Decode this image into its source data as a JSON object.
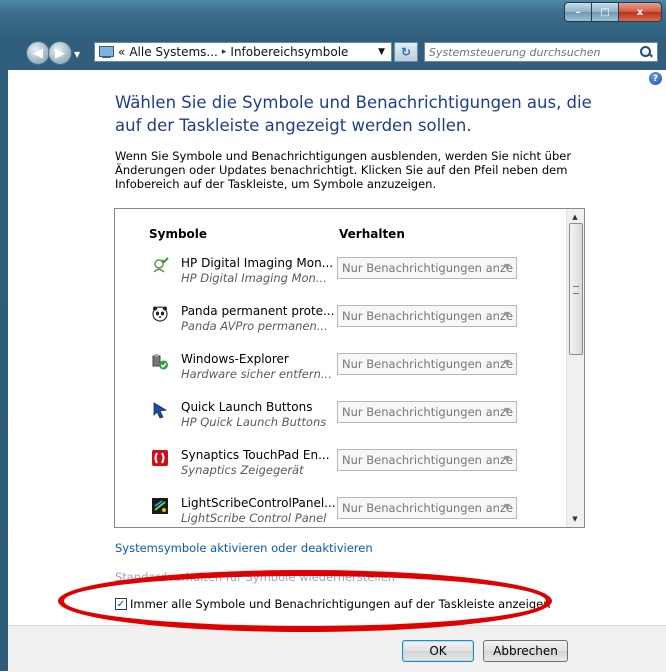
{
  "window": {
    "caption_buttons": {
      "minimize": "–",
      "maximize": "□",
      "close": "x"
    }
  },
  "nav": {
    "address": {
      "prefix": "«",
      "crumb1": "Alle Systems...",
      "separator": "▸",
      "crumb2": "Infobereichsymbole"
    },
    "search_placeholder": "Systemsteuerung durchsuchen"
  },
  "content": {
    "help": "?",
    "heading": "Wählen Sie die Symbole und Benachrichtigungen aus, die auf der Taskleiste angezeigt werden sollen.",
    "description": "Wenn Sie Symbole und Benachrichtigungen ausblenden, werden Sie nicht über Änderungen oder Updates benachrichtigt. Klicken Sie auf den Pfeil neben dem Infobereich auf der Taskleiste, um Symbole anzuzeigen.",
    "list": {
      "col_symbols": "Symbole",
      "col_behavior": "Verhalten",
      "rows": [
        {
          "name": "HP Digital Imaging Mon...",
          "sub": "HP Digital Imaging Mon...",
          "behavior": "Nur Benachrichtigungen anze",
          "icon": "hp-imaging-icon"
        },
        {
          "name": "Panda permanent prote...",
          "sub": "Panda AVPro permanen...",
          "behavior": "Nur Benachrichtigungen anze",
          "icon": "panda-icon"
        },
        {
          "name": "Windows-Explorer",
          "sub": "Hardware sicher entfern...",
          "behavior": "Nur Benachrichtigungen anze",
          "icon": "usb-safe-remove-icon"
        },
        {
          "name": "Quick Launch Buttons",
          "sub": "HP Quick Launch Buttons",
          "behavior": "Nur Benachrichtigungen anze",
          "icon": "quick-launch-icon"
        },
        {
          "name": "Synaptics TouchPad En...",
          "sub": "Synaptics Zeigegerät",
          "behavior": "Nur Benachrichtigungen anze",
          "icon": "synaptics-icon"
        },
        {
          "name": "LightScribeControlPanel...",
          "sub": "LightScribe Control Panel",
          "behavior": "Nur Benachrichtigungen anze",
          "icon": "lightscribe-icon"
        }
      ]
    },
    "link_system_icons": "Systemsymbole aktivieren oder deaktivieren",
    "link_default": "Standardverhalten für Symbole wiederherstellen",
    "checkbox_label": "Immer alle Symbole und Benachrichtigungen auf der Taskleiste anzeigen",
    "checkbox_checked": true
  },
  "footer": {
    "ok": "OK",
    "cancel": "Abbrechen"
  },
  "colors": {
    "heading": "#1e3d8f",
    "link": "#0a59b8",
    "highlight": "#e10000"
  }
}
